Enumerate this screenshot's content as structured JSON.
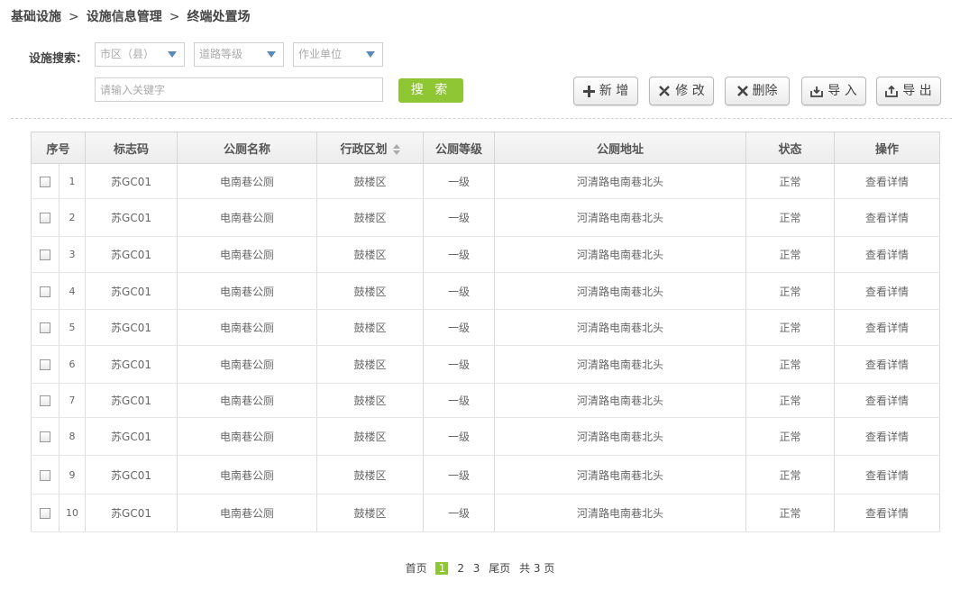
{
  "breadcrumb": [
    "基础设施",
    "设施信息管理",
    "终端处置场"
  ],
  "breadcrumb_sep": ">",
  "search": {
    "label": "设施搜索：",
    "district_placeholder": "市区（县）",
    "road_placeholder": "道路等级",
    "unit_placeholder": "作业单位",
    "keyword_placeholder": "请输入关键字",
    "button": "搜 索"
  },
  "toolbar": {
    "add": "新 增",
    "edit": "修 改",
    "delete": "删除",
    "import": "导 入",
    "export": "导 出"
  },
  "table": {
    "headers": [
      "序号",
      "标志码",
      "公厕名称",
      "行政区划",
      "公厕等级",
      "公厕地址",
      "状态",
      "操作"
    ],
    "rows": [
      {
        "no": "1",
        "code": "苏GC01",
        "name": "电南巷公厕",
        "district": "鼓楼区",
        "level": "一级",
        "address": "河清路电南巷北头",
        "status": "正常",
        "action": "查看详情"
      },
      {
        "no": "2",
        "code": "苏GC01",
        "name": "电南巷公厕",
        "district": "鼓楼区",
        "level": "一级",
        "address": "河清路电南巷北头",
        "status": "正常",
        "action": "查看详情"
      },
      {
        "no": "3",
        "code": "苏GC01",
        "name": "电南巷公厕",
        "district": "鼓楼区",
        "level": "一级",
        "address": "河清路电南巷北头",
        "status": "正常",
        "action": "查看详情"
      },
      {
        "no": "4",
        "code": "苏GC01",
        "name": "电南巷公厕",
        "district": "鼓楼区",
        "level": "一级",
        "address": "河清路电南巷北头",
        "status": "正常",
        "action": "查看详情"
      },
      {
        "no": "5",
        "code": "苏GC01",
        "name": "电南巷公厕",
        "district": "鼓楼区",
        "level": "一级",
        "address": "河清路电南巷北头",
        "status": "正常",
        "action": "查看详情"
      },
      {
        "no": "6",
        "code": "苏GC01",
        "name": "电南巷公厕",
        "district": "鼓楼区",
        "level": "一级",
        "address": "河清路电南巷北头",
        "status": "正常",
        "action": "查看详情"
      },
      {
        "no": "7",
        "code": "苏GC01",
        "name": "电南巷公厕",
        "district": "鼓楼区",
        "level": "一级",
        "address": "河清路电南巷北头",
        "status": "正常",
        "action": "查看详情"
      },
      {
        "no": "8",
        "code": "苏GC01",
        "name": "电南巷公厕",
        "district": "鼓楼区",
        "level": "一级",
        "address": "河清路电南巷北头",
        "status": "正常",
        "action": "查看详情"
      },
      {
        "no": "9",
        "code": "苏GC01",
        "name": "电南巷公厕",
        "district": "鼓楼区",
        "level": "一级",
        "address": "河清路电南巷北头",
        "status": "正常",
        "action": "查看详情"
      },
      {
        "no": "10",
        "code": "苏GC01",
        "name": "电南巷公厕",
        "district": "鼓楼区",
        "level": "一级",
        "address": "河清路电南巷北头",
        "status": "正常",
        "action": "查看详情"
      }
    ]
  },
  "pager": {
    "first": "首页",
    "pages": [
      "1",
      "2",
      "3"
    ],
    "current": "1",
    "last": "尾页",
    "total": "共 3 页"
  },
  "colors": {
    "accent": "#8ec634",
    "dropdown_arrow": "#5a8bb8"
  }
}
